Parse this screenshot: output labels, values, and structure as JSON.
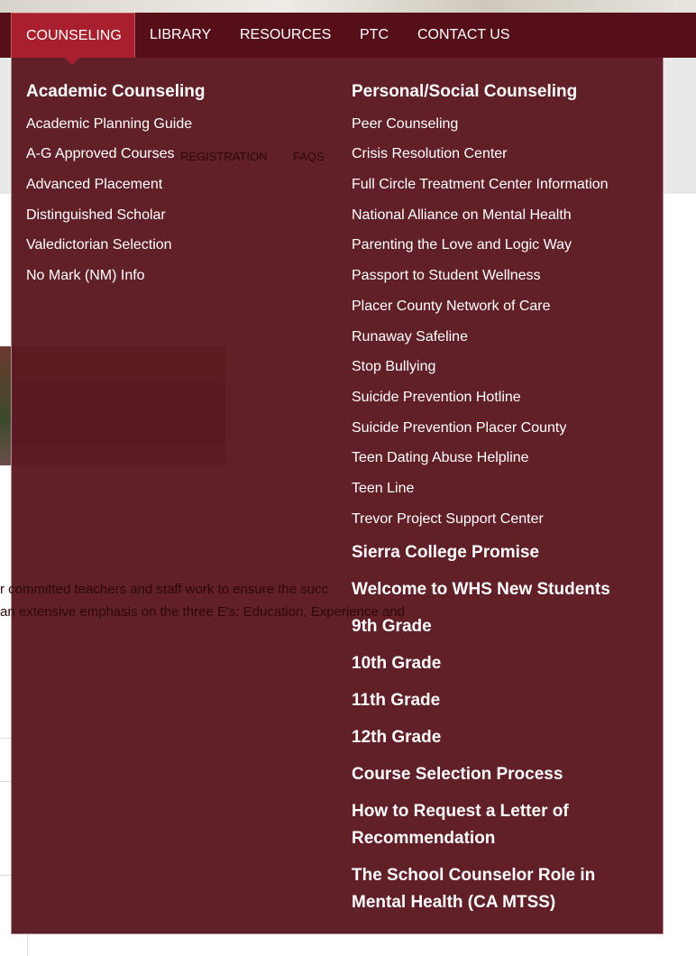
{
  "nav": {
    "items": [
      {
        "label": "COUNSELING",
        "active": true
      },
      {
        "label": "LIBRARY"
      },
      {
        "label": "RESOURCES"
      },
      {
        "label": "PTC"
      },
      {
        "label": "CONTACT US"
      }
    ]
  },
  "background": {
    "quicklinks": [
      "REGISTRATION",
      "FAQS"
    ],
    "paragraph": [
      "r committed teachers and staff work to ensure the succ",
      "an extensive emphasis on the three E's: Education, Experience and"
    ]
  },
  "dropdown": {
    "academic": {
      "heading": "Academic Counseling",
      "items": [
        "Academic Planning Guide",
        "A-G Approved Courses",
        "Advanced Placement",
        "Distinguished Scholar",
        "Valedictorian Selection",
        "No Mark (NM) Info"
      ]
    },
    "personal": {
      "heading": "Personal/Social Counseling",
      "items": [
        "Peer Counseling",
        "Crisis Resolution Center",
        "Full Circle Treatment Center Information",
        "National Alliance on Mental Health",
        "Parenting the Love and Logic Way",
        "Passport to Student Wellness",
        "Placer County Network of Care",
        "Runaway Safeline",
        "Stop Bullying",
        "Suicide Prevention Hotline",
        "Suicide Prevention Placer County",
        "Teen Dating Abuse Helpline",
        "Teen Line",
        "Trevor Project Support Center"
      ]
    },
    "sections": [
      "Sierra College Promise",
      "Welcome to WHS New Students",
      "9th Grade",
      "10th Grade",
      "11th Grade",
      "12th Grade",
      "Course Selection Process",
      "How to Request a Letter of Recommendation",
      "The School Counselor Role in Mental Health (CA MTSS)"
    ]
  },
  "colors": {
    "nav": "#560f18",
    "active": "#a81f2e",
    "dropdown": "#5c1921"
  }
}
